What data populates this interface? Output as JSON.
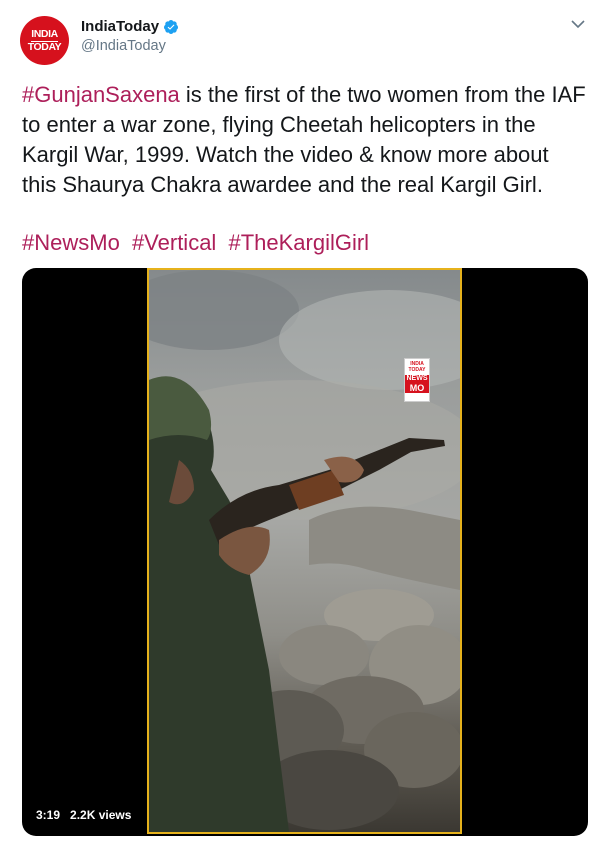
{
  "account": {
    "avatar_text_line1": "INDIA",
    "avatar_text_line2": "TODAY",
    "display_name": "IndiaToday",
    "handle": "@IndiaToday",
    "verified_icon": "verified-badge-icon",
    "brand_color": "#d6111d"
  },
  "tweet": {
    "hashtag_lead": "#GunjanSaxena",
    "text_rest": " is the first of the two women from the IAF to enter a war zone, flying Cheetah helicopters in the Kargil War, 1999. Watch the video & know more about this Shaurya Chakra awardee and the real Kargil Girl.",
    "hashtags": [
      "#NewsMo",
      "#Vertical",
      "#TheKargilGirl"
    ],
    "hashtag_color": "#ad1f5a"
  },
  "video": {
    "duration": "3:19",
    "views": "2.2K views",
    "watermark_top": "INDIA TODAY",
    "watermark_news": "NEWS",
    "watermark_mo": "MO",
    "frame_border_color": "#e6b21c"
  },
  "menu": {
    "icon": "chevron-down-icon"
  }
}
